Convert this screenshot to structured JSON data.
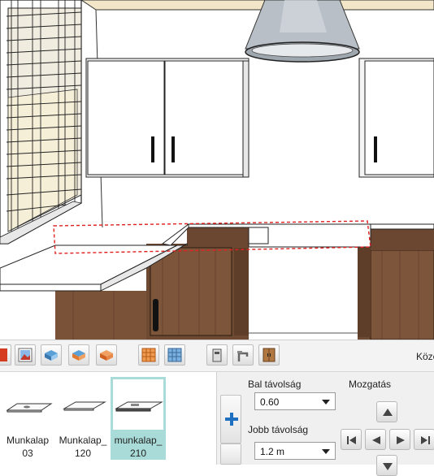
{
  "toolbar": {
    "label_partial": "Közé",
    "buttons": [
      {
        "name": "red-tool-icon"
      },
      {
        "name": "picture-icon"
      },
      {
        "name": "surface-blue-icon"
      },
      {
        "name": "surface-blue-orange-icon"
      },
      {
        "name": "surface-orange-icon"
      },
      {
        "name": "grid-orange-icon"
      },
      {
        "name": "grid-blue-icon"
      },
      {
        "name": "appliance-icon"
      },
      {
        "name": "faucet-icon"
      },
      {
        "name": "cabinet-icon"
      }
    ]
  },
  "gallery": {
    "items": [
      {
        "label": "Munkalap\n03",
        "selected": false
      },
      {
        "label": "Munkalap_\n120",
        "selected": false
      },
      {
        "label": "munkalap_\n210",
        "selected": true
      }
    ]
  },
  "props": {
    "left_distance_label": "Bal távolság",
    "left_distance_value": "0.60",
    "right_distance_label": "Jobb távolság",
    "right_distance_value": "1.2 m",
    "move_label": "Mozgatás"
  }
}
